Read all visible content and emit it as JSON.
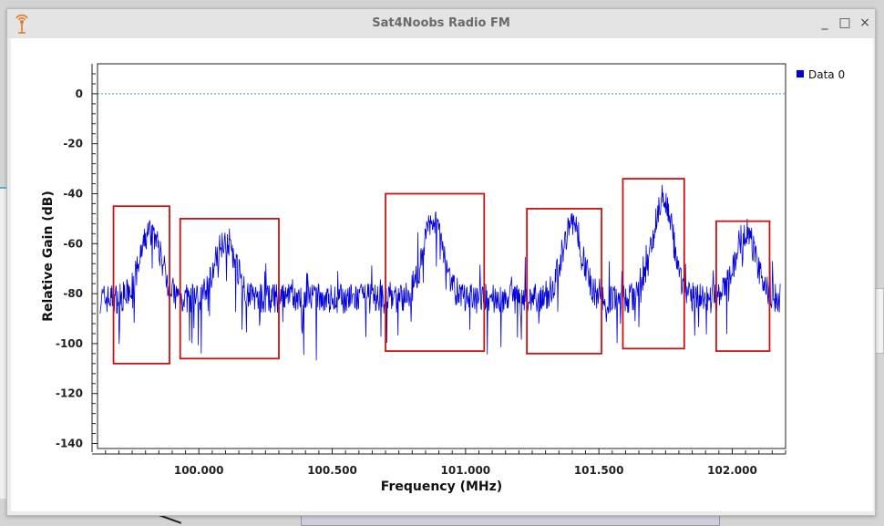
{
  "window": {
    "title": "Sat4Noobs Radio FM",
    "minimize_glyph": "_",
    "maximize_glyph": "□",
    "close_glyph": "×",
    "icon": "antenna-icon"
  },
  "colors": {
    "series": "#0000dd",
    "highlight_box": "#cc1111",
    "reference_line": "#2aa0c8"
  },
  "chart_data": {
    "type": "line",
    "xlabel": "Frequency (MHz)",
    "ylabel": "Relative Gain (dB)",
    "xlim": [
      99.62,
      102.2
    ],
    "ylim": [
      -142,
      12
    ],
    "xticks": [
      100.0,
      100.5,
      101.0,
      101.5,
      102.0
    ],
    "xtick_labels": [
      "100.000",
      "100.500",
      "101.000",
      "101.500",
      "102.000"
    ],
    "yticks": [
      0,
      -20,
      -40,
      -60,
      -80,
      -100,
      -120,
      -140
    ],
    "ytick_labels": [
      "0",
      "-20",
      "-40",
      "-60",
      "-80",
      "-100",
      "-120",
      "-140"
    ],
    "reference_line_y": 0,
    "legend": {
      "placement": "top-right",
      "entries": [
        "Data 0"
      ]
    },
    "series": [
      {
        "name": "Data 0",
        "noise_floor_db": -82,
        "x_start": 99.63,
        "x_end": 102.18,
        "stations": [
          {
            "center": 99.82,
            "peak_db": -55
          },
          {
            "center": 100.1,
            "peak_db": -58
          },
          {
            "center": 100.88,
            "peak_db": -50
          },
          {
            "center": 101.4,
            "peak_db": -52
          },
          {
            "center": 101.74,
            "peak_db": -42
          },
          {
            "center": 102.05,
            "peak_db": -55
          }
        ]
      }
    ],
    "highlight_boxes": [
      {
        "x0": 99.68,
        "x1": 99.89,
        "y0": -108,
        "y1": -45
      },
      {
        "x0": 99.93,
        "x1": 100.3,
        "y0": -106,
        "y1": -50
      },
      {
        "x0": 100.7,
        "x1": 101.07,
        "y0": -103,
        "y1": -40
      },
      {
        "x0": 101.23,
        "x1": 101.51,
        "y0": -104,
        "y1": -46
      },
      {
        "x0": 101.59,
        "x1": 101.82,
        "y0": -102,
        "y1": -34
      },
      {
        "x0": 101.94,
        "x1": 102.14,
        "y0": -103,
        "y1": -51
      }
    ]
  }
}
